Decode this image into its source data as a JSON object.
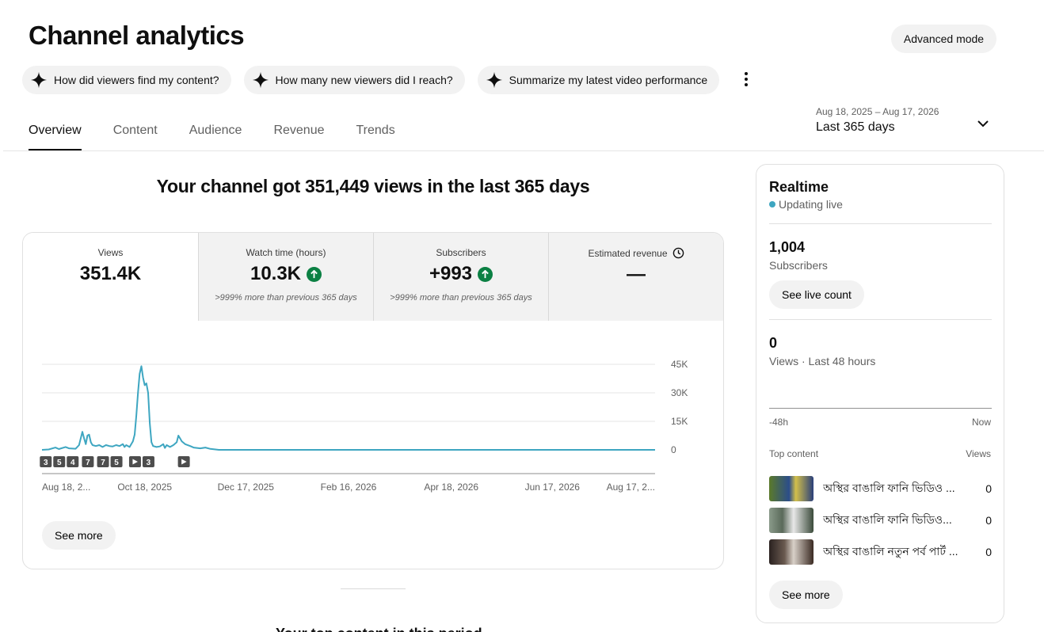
{
  "page": {
    "title": "Channel analytics",
    "advanced_mode_label": "Advanced mode"
  },
  "chips": [
    {
      "label": "How did viewers find my content?",
      "icon": "sparkle-icon"
    },
    {
      "label": "How many new viewers did I reach?",
      "icon": "sparkle-icon"
    },
    {
      "label": "Summarize my latest video performance",
      "icon": "sparkle-icon"
    }
  ],
  "tabs": [
    {
      "label": "Overview",
      "active": true
    },
    {
      "label": "Content",
      "active": false
    },
    {
      "label": "Audience",
      "active": false
    },
    {
      "label": "Revenue",
      "active": false
    },
    {
      "label": "Trends",
      "active": false
    }
  ],
  "date_picker": {
    "range": "Aug 18, 2025 – Aug 17, 2026",
    "label": "Last 365 days"
  },
  "headline": "Your channel got 351,449 views in the last 365 days",
  "metrics": [
    {
      "label": "Views",
      "value": "351.4K",
      "sub": "",
      "trend": ""
    },
    {
      "label": "Watch time (hours)",
      "value": "10.3K",
      "sub": ">999% more than previous 365 days",
      "trend": "up"
    },
    {
      "label": "Subscribers",
      "value": "+993",
      "sub": ">999% more than previous 365 days",
      "trend": "up"
    },
    {
      "label": "Estimated revenue",
      "value": "—",
      "sub": "",
      "trend": ""
    }
  ],
  "card_see_more": "See more",
  "chart_data": {
    "type": "line",
    "series_color": "#3ea6c1",
    "ylim": [
      0,
      45000
    ],
    "yticks": [
      "45K",
      "30K",
      "15K",
      "0"
    ],
    "ytick_values": [
      45000,
      30000,
      15000,
      0
    ],
    "xticks": [
      "Aug 18, 2...",
      "Oct 18, 2025",
      "Dec 17, 2025",
      "Feb 16, 2026",
      "Apr 18, 2026",
      "Jun 17, 2026",
      "Aug 17, 2..."
    ],
    "xtick_day_index": [
      0,
      61,
      121,
      182,
      243,
      303,
      364
    ],
    "markers": [
      {
        "label": "3",
        "day": 2
      },
      {
        "label": "5",
        "day": 10
      },
      {
        "label": "4",
        "day": 18
      },
      {
        "label": "7",
        "day": 27
      },
      {
        "label": "7",
        "day": 36
      },
      {
        "label": "5",
        "day": 44
      },
      {
        "label": "play",
        "day": 55
      },
      {
        "label": "3",
        "day": 63
      },
      {
        "label": "play",
        "day": 84
      }
    ],
    "points": [
      [
        0,
        0
      ],
      [
        4,
        200
      ],
      [
        8,
        1200
      ],
      [
        10,
        400
      ],
      [
        14,
        1500
      ],
      [
        16,
        800
      ],
      [
        20,
        600
      ],
      [
        22,
        2500
      ],
      [
        24,
        9500
      ],
      [
        25,
        6000
      ],
      [
        26,
        3000
      ],
      [
        27,
        7500
      ],
      [
        28,
        8000
      ],
      [
        29,
        4000
      ],
      [
        30,
        2500
      ],
      [
        32,
        2000
      ],
      [
        34,
        2500
      ],
      [
        36,
        1500
      ],
      [
        38,
        2500
      ],
      [
        40,
        2000
      ],
      [
        42,
        1800
      ],
      [
        44,
        2500
      ],
      [
        46,
        2000
      ],
      [
        48,
        3000
      ],
      [
        49,
        1500
      ],
      [
        50,
        2500
      ],
      [
        52,
        1500
      ],
      [
        54,
        4500
      ],
      [
        55,
        8000
      ],
      [
        56,
        18000
      ],
      [
        57,
        30000
      ],
      [
        58,
        40000
      ],
      [
        59,
        44000
      ],
      [
        60,
        38000
      ],
      [
        61,
        34000
      ],
      [
        62,
        35000
      ],
      [
        63,
        30000
      ],
      [
        64,
        14000
      ],
      [
        65,
        4000
      ],
      [
        66,
        2000
      ],
      [
        68,
        1500
      ],
      [
        70,
        1800
      ],
      [
        72,
        3000
      ],
      [
        73,
        1000
      ],
      [
        74,
        2500
      ],
      [
        76,
        1500
      ],
      [
        78,
        2500
      ],
      [
        80,
        4000
      ],
      [
        81,
        7500
      ],
      [
        82,
        6000
      ],
      [
        83,
        4500
      ],
      [
        85,
        3000
      ],
      [
        88,
        2000
      ],
      [
        90,
        1200
      ],
      [
        94,
        800
      ],
      [
        97,
        1200
      ],
      [
        100,
        500
      ],
      [
        105,
        0
      ],
      [
        364,
        0
      ]
    ]
  },
  "realtime": {
    "title": "Realtime",
    "status": "Updating live",
    "subscribers_value": "1,004",
    "subscribers_label": "Subscribers",
    "live_count_label": "See live count",
    "views_value": "0",
    "views_label": "Views · Last 48 hours",
    "axis_start": "-48h",
    "axis_end": "Now",
    "top_content_header": "Top content",
    "views_header": "Views",
    "top_content": [
      {
        "title": "অস্থির বাঙালি ফানি ভিডিও ...",
        "views": "0",
        "thumb_color": "#4a6a2a"
      },
      {
        "title": "অস্থির বাঙালি ফানি ভিডিও...",
        "views": "0",
        "thumb_color": "#6b7a6a"
      },
      {
        "title": "অস্থির বাঙালি নতুন পর্ব পার্ট ...",
        "views": "0",
        "thumb_color": "#3e3430"
      }
    ],
    "see_more_label": "See more"
  },
  "below_card_text": "Your top content in this period"
}
